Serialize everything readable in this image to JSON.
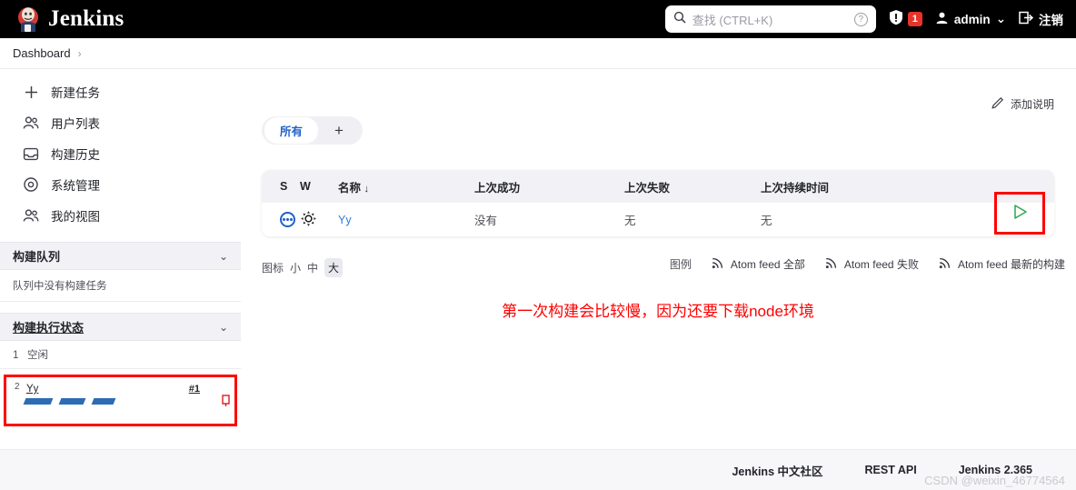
{
  "topbar": {
    "brand": "Jenkins",
    "search_placeholder": "查找 (CTRL+K)",
    "help_glyph": "?",
    "warning_badge": "1",
    "user": "admin",
    "user_chevron": "⌄",
    "logout": "注销"
  },
  "breadcrumb": {
    "root": "Dashboard",
    "separator": "›"
  },
  "sidebar": {
    "items": [
      {
        "label": "新建任务",
        "icon": "plus-icon"
      },
      {
        "label": "用户列表",
        "icon": "people-icon"
      },
      {
        "label": "构建历史",
        "icon": "inbox-icon"
      },
      {
        "label": "系统管理",
        "icon": "gear-icon"
      },
      {
        "label": "我的视图",
        "icon": "people-icon"
      }
    ],
    "build_queue": {
      "title": "构建队列",
      "chevron": "⌄",
      "empty_text": "队列中没有构建任务"
    },
    "executors": {
      "title": "构建执行状态",
      "chevron": "⌄",
      "idle": {
        "num": "1",
        "label": "空闲"
      },
      "running": {
        "num": "2",
        "job": "Yy",
        "build": "#1"
      }
    }
  },
  "main": {
    "add_description": "添加说明",
    "tabs": {
      "active": "所有",
      "add": "+"
    },
    "table": {
      "headers": {
        "s": "S",
        "w": "W",
        "name": "名称",
        "sort_arrow": "↓",
        "last_success": "上次成功",
        "last_failure": "上次失败",
        "last_duration": "上次持续时间"
      },
      "rows": [
        {
          "status_icon": "pending-ball-icon",
          "weather_icon": "sunny-icon",
          "name": "Yy",
          "last_success": "没有",
          "last_failure": "无",
          "last_duration": "无",
          "action": "build-now-icon"
        }
      ]
    },
    "icon_size": {
      "label": "图标",
      "options": [
        "小",
        "中",
        "大"
      ],
      "selected": "大"
    },
    "legend": "图例",
    "feeds": [
      "Atom feed 全部",
      "Atom feed 失败",
      "Atom feed 最新的构建"
    ],
    "note": "第一次构建会比较慢，因为还要下载node环境"
  },
  "footer": {
    "community": "Jenkins 中文社区",
    "rest_api": "REST API",
    "version": "Jenkins 2.365",
    "watermark": "CSDN @weixin_46774564"
  },
  "colors": {
    "accent_blue": "#1f62c8",
    "link_blue": "#2b7bd6",
    "danger_red": "#e8332a",
    "highlight_red": "#ff0000",
    "build_green": "#2aa84a",
    "progress_blue": "#2d6cb4"
  }
}
